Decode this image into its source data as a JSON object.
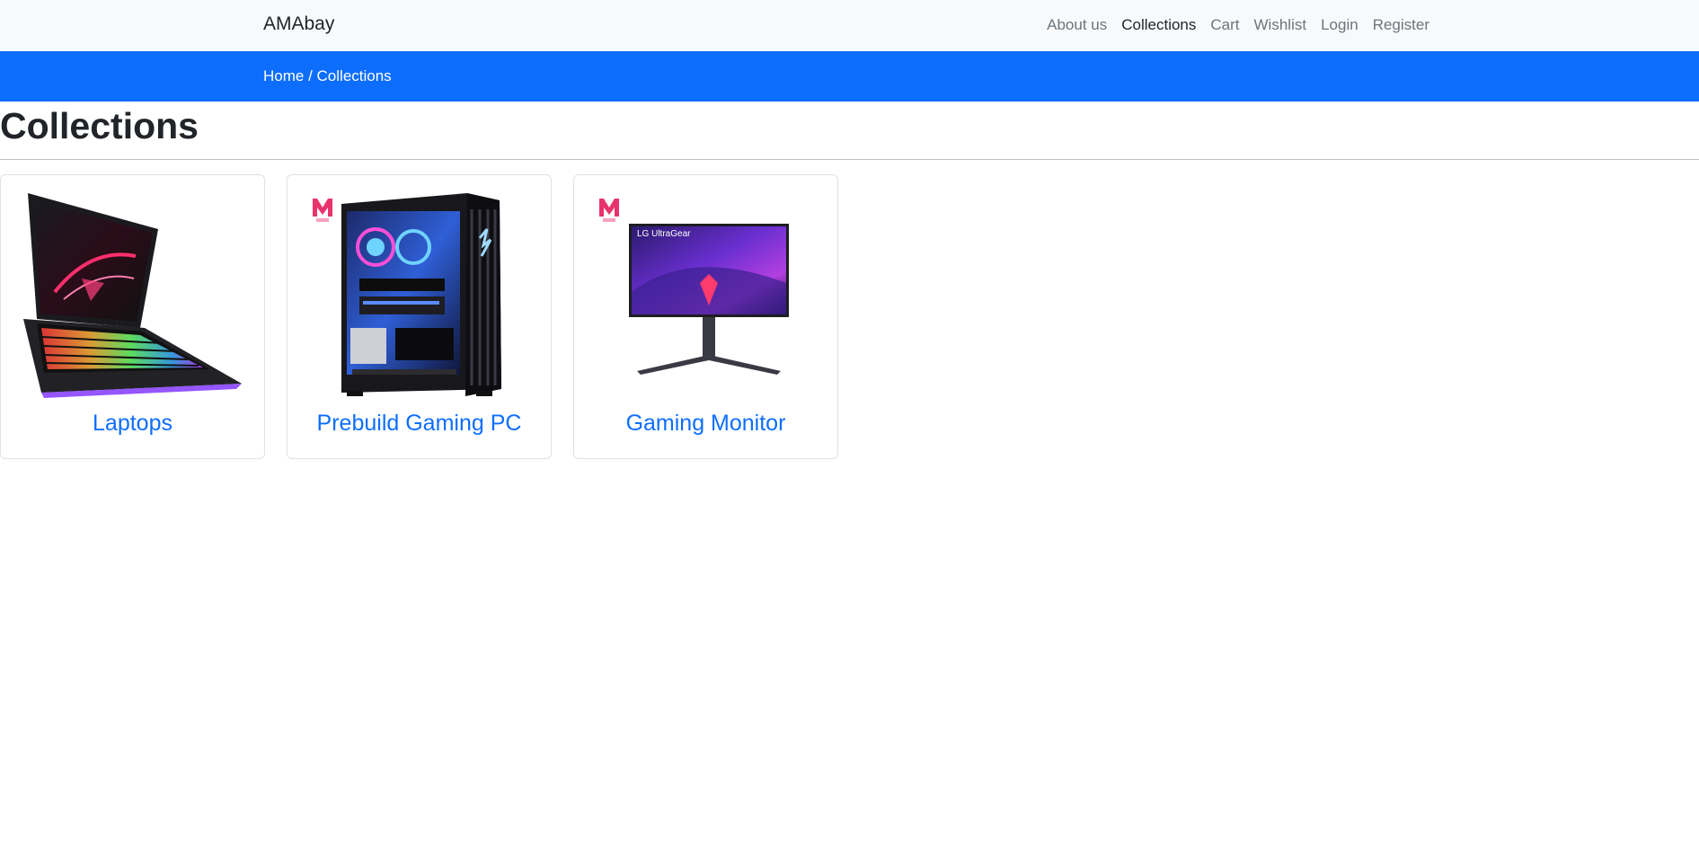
{
  "brand": "AMAbay",
  "nav": {
    "about": "About us",
    "collections": "Collections",
    "cart": "Cart",
    "wishlist": "Wishlist",
    "login": "Login",
    "register": "Register"
  },
  "breadcrumb": {
    "home": "Home",
    "separator": " / ",
    "current": "Collections"
  },
  "page": {
    "title": "Collections"
  },
  "cards": [
    {
      "title": "Laptops",
      "image": "laptop-image"
    },
    {
      "title": "Prebuild Gaming PC",
      "image": "gaming-pc-image"
    },
    {
      "title": "Gaming Monitor",
      "image": "gaming-monitor-image"
    }
  ],
  "monitor_brand_text": "LG UltraGear",
  "colors": {
    "primary": "#0d6efd",
    "navbar_bg": "#f8f9fa",
    "logo_pink": "#e8336d"
  }
}
